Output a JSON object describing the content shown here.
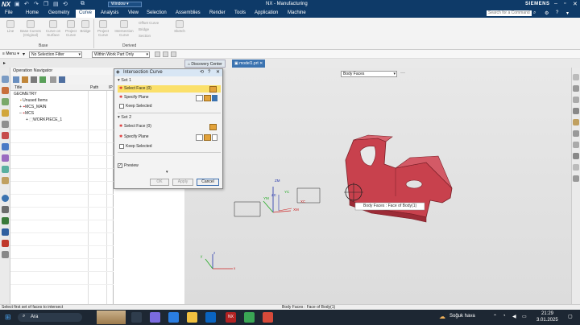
{
  "titlebar": {
    "logo": "NX",
    "window_menu": "Window",
    "title": "NX - Manufacturing",
    "brand": "SIEMENS"
  },
  "menubar": {
    "items": [
      "File",
      "Home",
      "Geometry",
      "Curve",
      "Analysis",
      "View",
      "Selection",
      "Assemblies",
      "Render",
      "Tools",
      "Application",
      "Machine"
    ],
    "search_placeholder": "Search for a Command"
  },
  "ribbon": {
    "base_buttons": [
      "Line",
      "Base Curves (Original)",
      "Curve on Surface",
      "Project Curve",
      "Bridge"
    ],
    "derived_buttons": [
      "Project Curve",
      "Intersection Curve",
      "Offset Curve",
      "Bridge",
      "Section",
      "Sketch"
    ],
    "group_base": "Base",
    "group_derived": "Derived"
  },
  "selbar": {
    "menu": "Menu",
    "filter": "No Selection Filter",
    "scope": "Within Work Part Only"
  },
  "tabs": {
    "discovery": "Discovery Center",
    "model": "model1.prt"
  },
  "navigator": {
    "title": "Operation Navigator",
    "col_title": "Title",
    "col_path": "Path",
    "col_ip": "IP",
    "rows": [
      "GEOMETRY",
      "Unused Items",
      "MCS_MAIN",
      "MCS",
      "WORKPIECE_1"
    ]
  },
  "dialog": {
    "title": "Intersection Curve",
    "set1": "Set 1",
    "set2": "Set 2",
    "select_face1": "Select Face (0)",
    "specify_plane1": "Specify Plane",
    "keep1": "Keep Selected",
    "select_face2": "Select Face (0)",
    "specify_plane2": "Specify Plane",
    "keep2": "Keep Selected",
    "preview": "Preview",
    "ok": "OK",
    "apply": "Apply",
    "cancel": "Cancel"
  },
  "viewport": {
    "face_filter": "Body Faces",
    "tooltip": "Body Faces : Face of Body(1)",
    "axis_zm": "ZM",
    "axis_zc": "ZC",
    "axis_xm": "XM",
    "axis_xc": "XC",
    "axis_ym": "YM",
    "axis_yc": "YC"
  },
  "status": {
    "left": "Select first set of faces to intersect",
    "center": "Body Faces : Face of Body(1)"
  },
  "taskbar": {
    "search": "Ara",
    "weather": "Soğuk hava",
    "time": "21:29",
    "date": "3.01.2025"
  },
  "colors": {
    "title_bg": "#0e3a68",
    "part_red": "#c8414d",
    "highlight_yellow": "#fbe06a"
  }
}
